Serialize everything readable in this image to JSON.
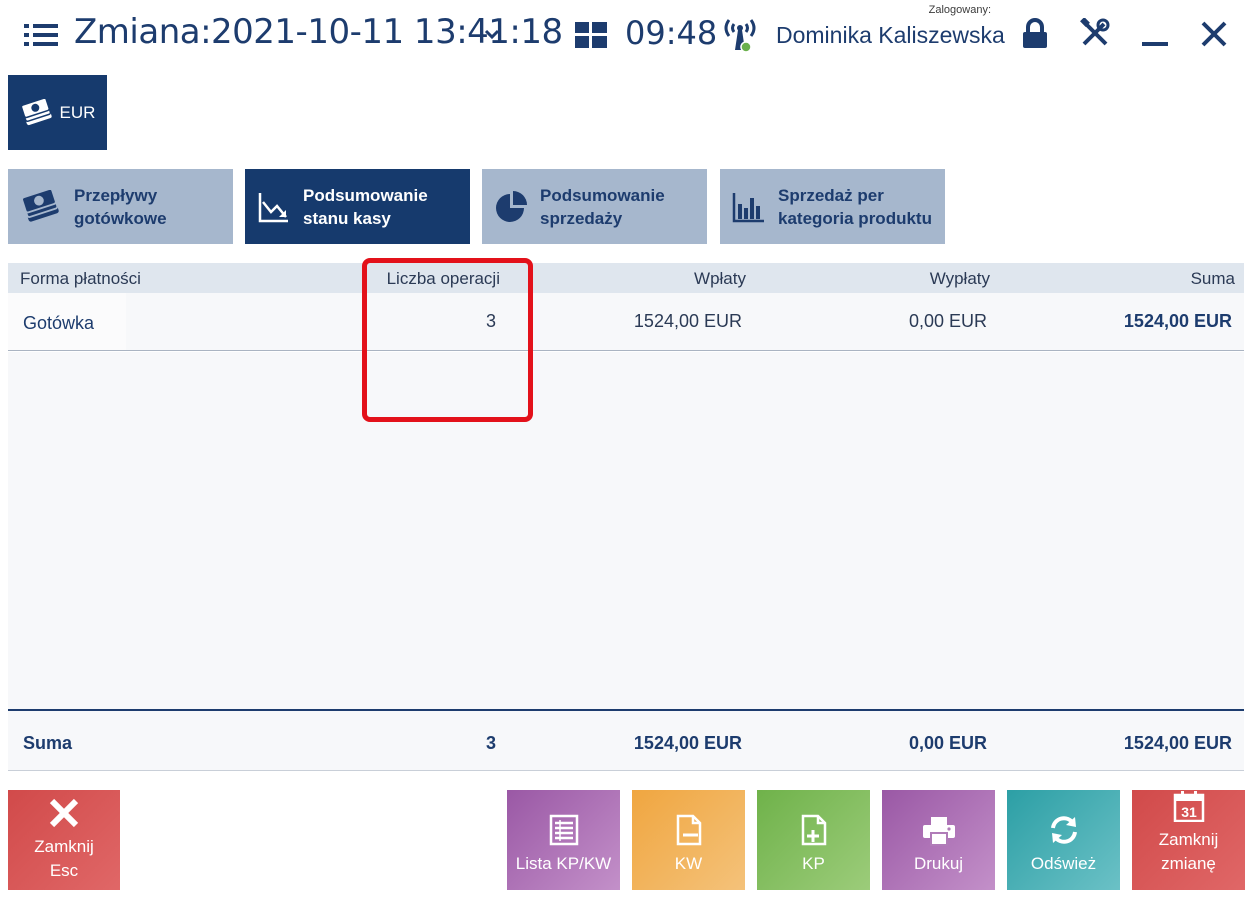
{
  "header": {
    "shift_title": "Zmiana:2021-10-11 13:41:18",
    "clock": "09:48",
    "logged_label": "Zalogowany:",
    "user_name": "Dominika Kaliszewska"
  },
  "currency": {
    "label": "EUR"
  },
  "tabs": [
    {
      "label": "Przepływy\ngotówkowe",
      "icon": "cash-icon",
      "active": false
    },
    {
      "label": "Podsumowanie\nstanu kasy",
      "icon": "trend-chart-icon",
      "active": true
    },
    {
      "label": "Podsumowanie\nsprzedaży",
      "icon": "pie-chart-icon",
      "active": false
    },
    {
      "label": "Sprzedaż per\nkategoria produktu",
      "icon": "bar-chart-icon",
      "active": false
    }
  ],
  "table": {
    "columns": [
      "Forma płatności",
      "Liczba operacji",
      "Wpłaty",
      "Wypłaty",
      "Suma"
    ],
    "rows": [
      {
        "method": "Gotówka",
        "count": "3",
        "in": "1524,00 EUR",
        "out": "0,00 EUR",
        "sum": "1524,00 EUR"
      }
    ],
    "summary": {
      "label": "Suma",
      "count": "3",
      "in": "1524,00 EUR",
      "out": "0,00 EUR",
      "sum": "1524,00 EUR"
    }
  },
  "buttons": {
    "close": "Zamknij\nEsc",
    "list": "Lista KP/KW",
    "kw": "KW",
    "kp": "KP",
    "print": "Drukuj",
    "refresh": "Odśwież",
    "close_shift": "Zamknij\nzmianę",
    "calendar_day": "31"
  },
  "colors": {
    "primary": "#163a6d",
    "tab_inactive": "#a6b7cd",
    "highlight": "#e3111a",
    "online": "#6ab04c"
  }
}
